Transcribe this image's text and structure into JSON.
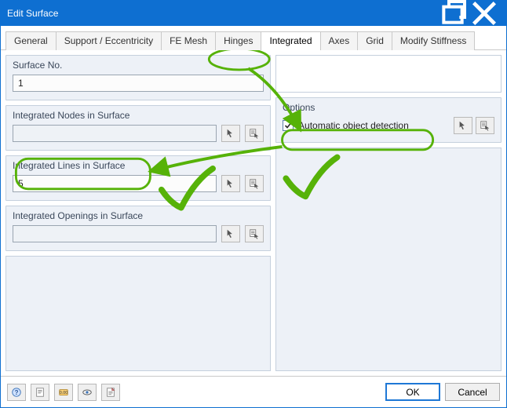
{
  "window": {
    "title": "Edit Surface",
    "restore_tooltip": "Restore",
    "close_tooltip": "Close"
  },
  "tabs": {
    "general": "General",
    "support": "Support / Eccentricity",
    "fe_mesh": "FE Mesh",
    "hinges": "Hinges",
    "integrated": "Integrated",
    "axes": "Axes",
    "grid": "Grid",
    "modify_stiffness": "Modify Stiffness"
  },
  "groups": {
    "surface_no": {
      "legend": "Surface No.",
      "value": "1"
    },
    "nodes": {
      "legend": "Integrated Nodes in Surface",
      "value": ""
    },
    "lines": {
      "legend": "Integrated Lines in Surface",
      "value": "5"
    },
    "openings": {
      "legend": "Integrated Openings in Surface",
      "value": ""
    },
    "options": {
      "legend": "Options",
      "auto_detect_label": "Automatic object detection",
      "auto_detect_checked": true
    }
  },
  "footer": {
    "ok": "OK",
    "cancel": "Cancel"
  },
  "icons": {
    "pick": "pick-icon",
    "select": "select-list-icon",
    "help": "help-icon",
    "details": "details-icon",
    "units": "units-icon",
    "view": "view-icon",
    "report": "report-icon"
  }
}
